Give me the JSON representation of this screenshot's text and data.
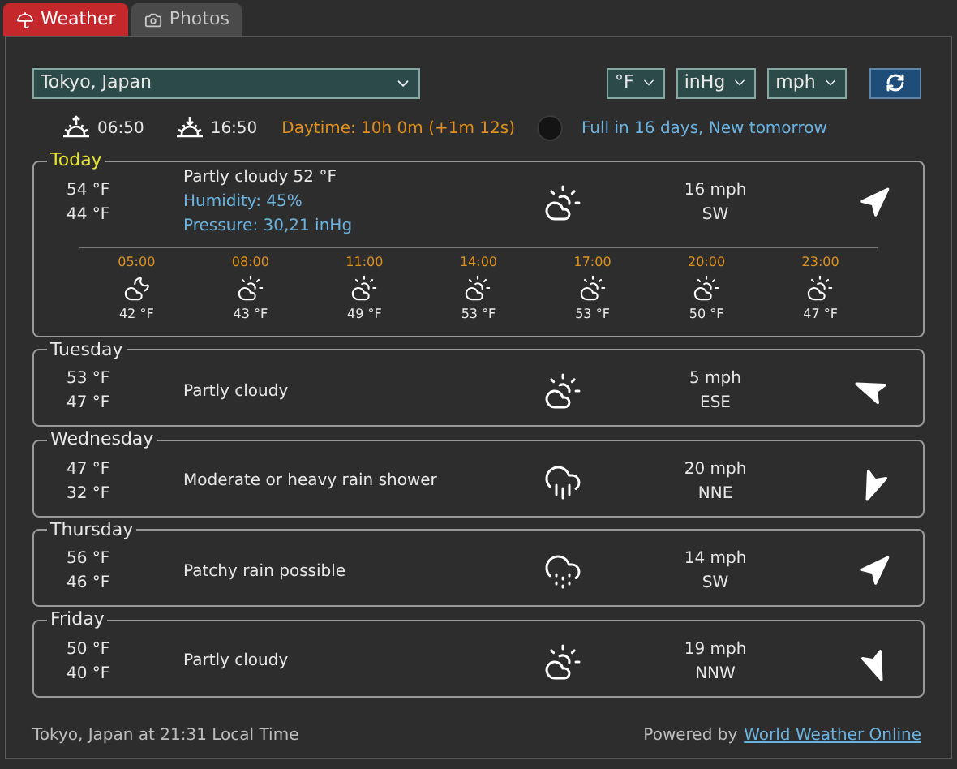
{
  "tabs": [
    {
      "label": "Weather",
      "selected": true
    },
    {
      "label": "Photos",
      "selected": false
    }
  ],
  "location": {
    "value": "Tokyo, Japan"
  },
  "units": [
    {
      "value": "°F"
    },
    {
      "value": "inHg"
    },
    {
      "value": "mph"
    }
  ],
  "sun": {
    "sunrise": "06:50",
    "sunset": "16:50",
    "daytime": "Daytime: 10h 0m (+1m 12s)"
  },
  "moon": {
    "text": "Full in 16 days, New tomorrow"
  },
  "today": {
    "title": "Today",
    "high": "54 °F",
    "low": "44 °F",
    "summary": "Partly cloudy 52 °F",
    "humidity": "Humidity: 45%",
    "pressure": "Pressure: 30,21 inHg",
    "kind": "partly-cloudy",
    "wind": "16 mph",
    "wind_dir": "SW",
    "arrow": {
      "kind": "ne"
    },
    "hours": [
      {
        "time": "05:00",
        "kind": "night",
        "temp": "42 °F"
      },
      {
        "time": "08:00",
        "kind": "partly-cloudy",
        "temp": "43 °F"
      },
      {
        "time": "11:00",
        "kind": "partly-cloudy",
        "temp": "49 °F"
      },
      {
        "time": "14:00",
        "kind": "partly-cloudy",
        "temp": "53 °F"
      },
      {
        "time": "17:00",
        "kind": "partly-cloudy",
        "temp": "53 °F"
      },
      {
        "time": "20:00",
        "kind": "partly-cloudy",
        "temp": "50 °F"
      },
      {
        "time": "23:00",
        "kind": "partly-cloudy",
        "temp": "47 °F"
      }
    ]
  },
  "days": [
    {
      "title": "Tuesday",
      "high": "53 °F",
      "low": "47 °F",
      "summary": "Partly cloudy",
      "kind": "partly-cloudy",
      "wind": "5 mph",
      "wind_dir": "ESE",
      "arrow": {
        "kind": "wnw"
      }
    },
    {
      "title": "Wednesday",
      "high": "47 °F",
      "low": "32 °F",
      "summary": "Moderate or heavy rain shower",
      "kind": "rain",
      "wind": "20 mph",
      "wind_dir": "NNE",
      "arrow": {
        "kind": "ssw"
      }
    },
    {
      "title": "Thursday",
      "high": "56 °F",
      "low": "46 °F",
      "summary": "Patchy rain possible",
      "kind": "drizzle",
      "wind": "14 mph",
      "wind_dir": "SW",
      "arrow": {
        "kind": "ne"
      }
    },
    {
      "title": "Friday",
      "high": "50 °F",
      "low": "40 °F",
      "summary": "Partly cloudy",
      "kind": "partly-cloudy",
      "wind": "19 mph",
      "wind_dir": "NNW",
      "arrow": {
        "kind": "sse"
      }
    }
  ],
  "footer": {
    "local_time": "Tokyo, Japan at 21:31 Local Time",
    "powered_by": "Powered by",
    "link": "World Weather Online"
  }
}
